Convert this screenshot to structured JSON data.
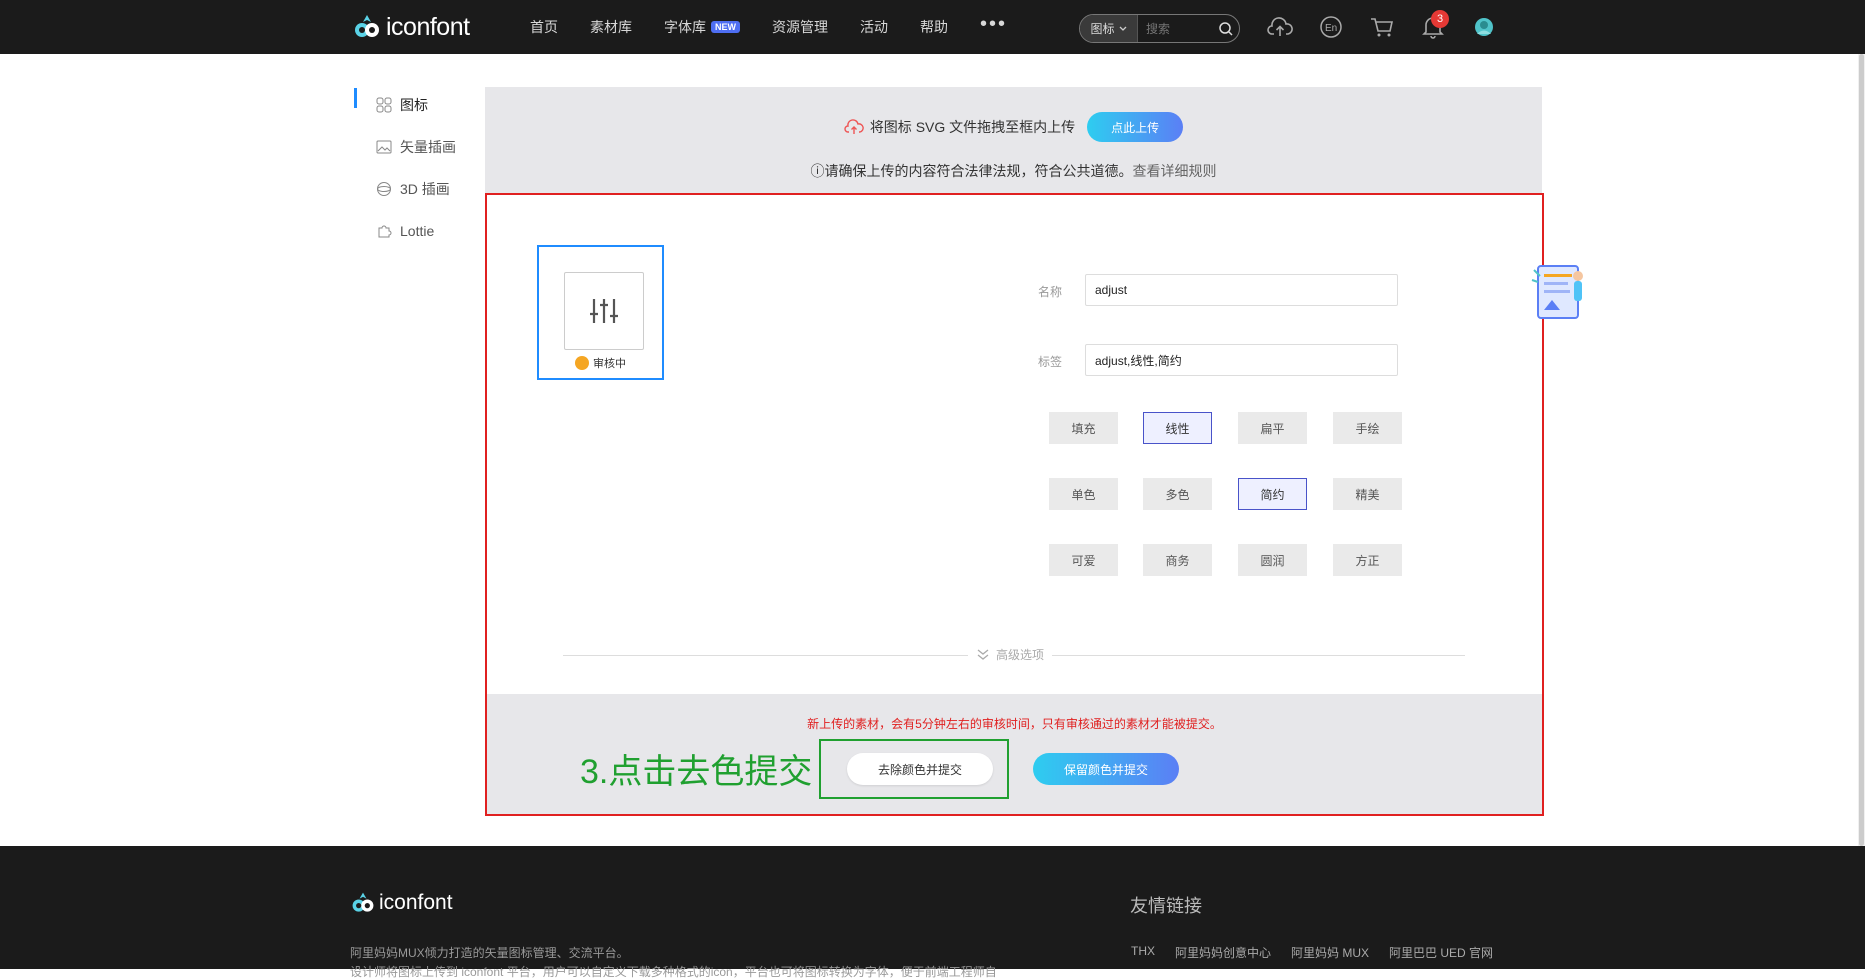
{
  "brand": {
    "name": "iconfont"
  },
  "nav": {
    "items": [
      "首页",
      "素材库",
      "字体库",
      "资源管理",
      "活动",
      "帮助"
    ],
    "new_badge": "NEW",
    "more": "•••"
  },
  "search": {
    "type": "图标",
    "placeholder": "搜索"
  },
  "notifications": {
    "count": "3"
  },
  "sidebar": {
    "items": [
      {
        "label": "图标",
        "active": true
      },
      {
        "label": "矢量插画"
      },
      {
        "label": "3D 插画"
      },
      {
        "label": "Lottie"
      }
    ]
  },
  "upload": {
    "hint": "将图标 SVG 文件拖拽至框内上传",
    "button": "点此上传",
    "notice": "请确保上传的内容符合法律法规，符合公共道德。",
    "rules_link": "查看详细规则"
  },
  "icon": {
    "status": "审核中",
    "icon_name": "adjust-icon"
  },
  "form": {
    "name_label": "名称",
    "name_value": "adjust",
    "tags_label": "标签",
    "tags_value": "adjust,线性,简约"
  },
  "styles": {
    "rows": [
      [
        "填充",
        "线性",
        "扁平",
        "手绘"
      ],
      [
        "单色",
        "多色",
        "简约",
        "精美"
      ],
      [
        "可爱",
        "商务",
        "圆润",
        "方正"
      ]
    ],
    "selected": [
      "线性",
      "简约"
    ]
  },
  "advanced": {
    "label": "高级选项"
  },
  "submit": {
    "warning": "新上传的素材，会有5分钟左右的审核时间，只有审核通过的素材才能被提交。",
    "annotation": "3.点击去色提交",
    "remove_color_button": "去除颜色并提交",
    "keep_color_button": "保留颜色并提交"
  },
  "footer": {
    "desc1": "阿里妈妈MUX倾力打造的矢量图标管理、交流平台。",
    "desc2": "设计师将图标上传到 iconfont 平台，用户可以自定义下载多种格式的icon，平台也可将图标转换为字体，便于前端工程师自",
    "friends_title": "友情链接",
    "links": [
      "THX",
      "阿里妈妈创意中心",
      "阿里妈妈 MUX",
      "阿里巴巴 UED 官网"
    ]
  },
  "colors": {
    "accent": "#1f8cff",
    "annotation_red": "#e02020",
    "annotation_green": "#20a030"
  }
}
